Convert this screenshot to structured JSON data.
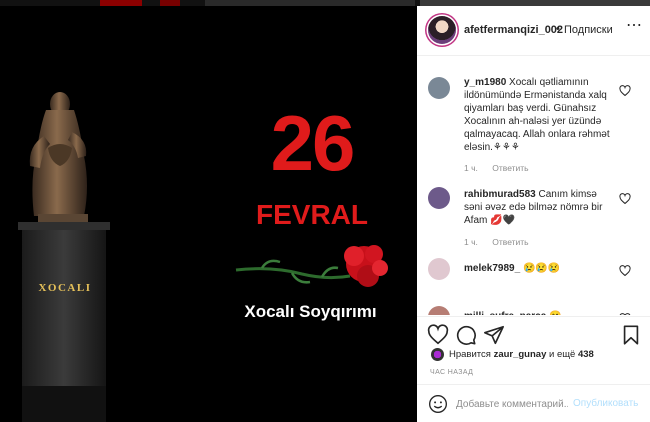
{
  "post": {
    "header": {
      "username": "afetfermanqizi_002",
      "separator": "•",
      "follow_label": "Подписки",
      "more_label": "⋯"
    },
    "media": {
      "poster_number": "26",
      "poster_month": "FEVRAL",
      "poster_caption": "Xocalı Soyqırımı",
      "pedestal_label": "XOCALI"
    },
    "comments": [
      {
        "username": "y_m1980",
        "text": "Xocalı qətliamının ildönümündə Ermənistanda xalq qiyamları baş verdi. Günahsız Xocalının ah-naləsi yer üzündə qalmayacaq. Allah onlara rəhmət eləsin.⚘⚘⚘",
        "time": "1 ч.",
        "reply_label": "Ответить",
        "avatar_color": "#7a8896"
      },
      {
        "username": "rahibmurad583",
        "text": "Canım kimsə səni əvəz edə bilməz nömrə bir Afam 💋🖤",
        "time": "1 ч.",
        "reply_label": "Ответить",
        "avatar_color": "#6d5a8a"
      },
      {
        "username": "melek7989_",
        "text": "😢😢😢",
        "time": "",
        "reply_label": "",
        "avatar_color": "#e0c8d0"
      },
      {
        "username": "milli_sufre_parca",
        "text": "😊",
        "time": "",
        "reply_label": "",
        "avatar_color": "#b67d74"
      }
    ],
    "likes": {
      "prefix": "Нравится ",
      "liker": "zaur_gunay",
      "middle": " и ещё ",
      "count": "438"
    },
    "time_ago": "ЧАС НАЗАД",
    "composer": {
      "placeholder": "Добавьте комментарий...",
      "publish_label": "Опубликовать"
    },
    "colors": {
      "accent_red": "#e01b1b",
      "publish_disabled": "#b2dffc",
      "muted_text": "#8e8e8e"
    },
    "icons": [
      "more-options-icon",
      "like-heart-icon",
      "comment-icon",
      "share-icon",
      "bookmark-icon",
      "emoji-icon"
    ]
  }
}
